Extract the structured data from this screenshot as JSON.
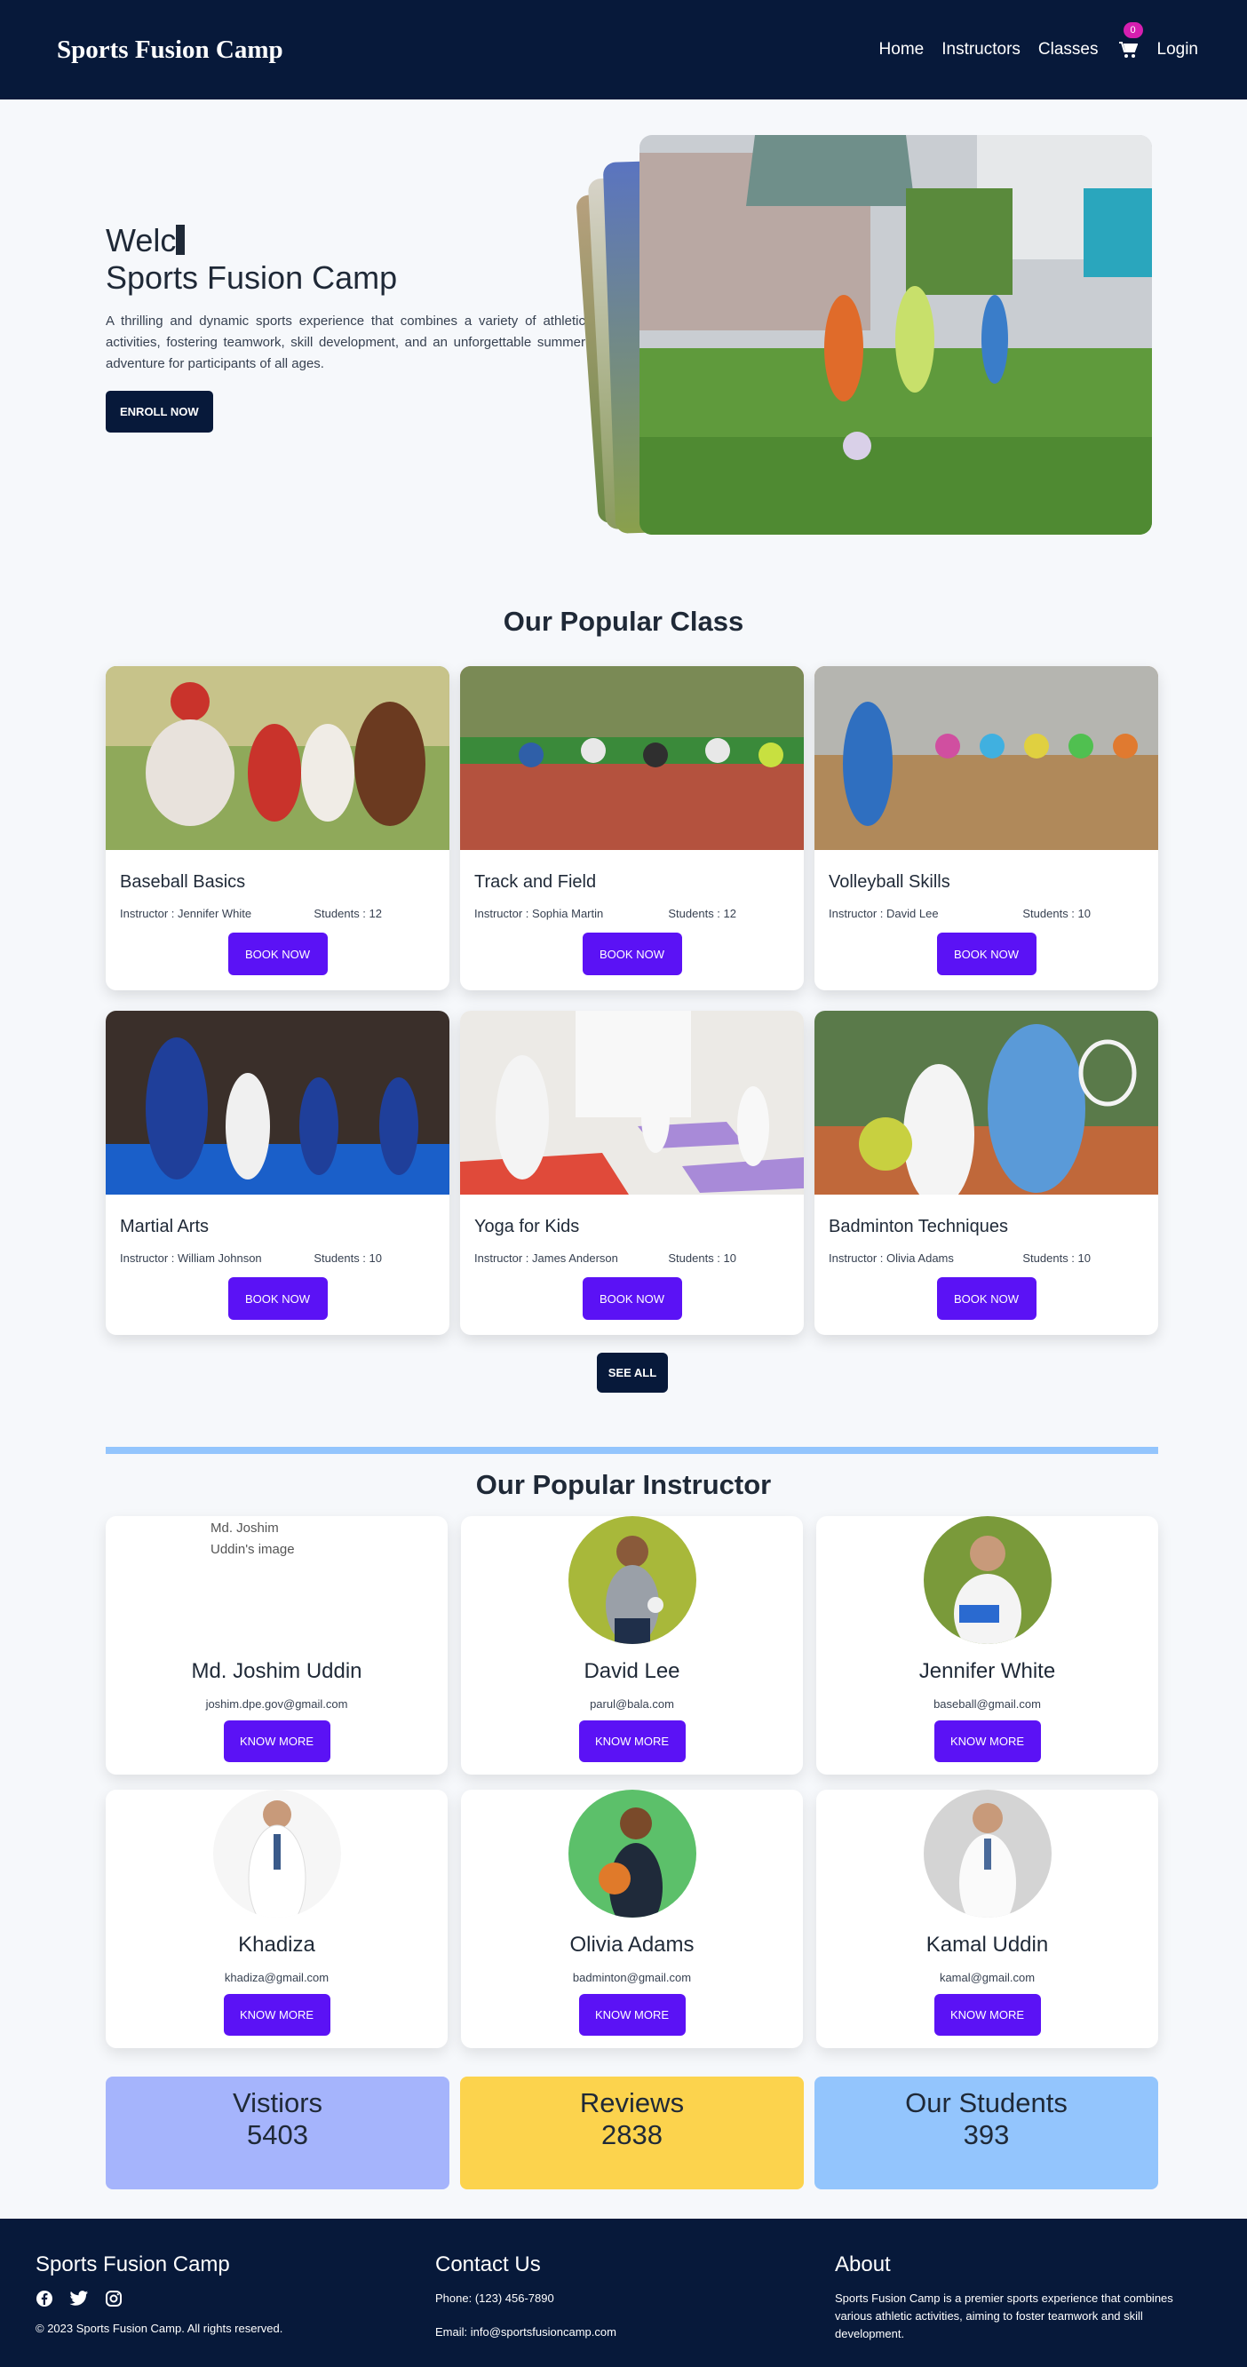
{
  "brand": "Sports Fusion Camp",
  "nav": {
    "home": "Home",
    "instructors": "Instructors",
    "classes": "Classes",
    "cart_count": "0",
    "login": "Login"
  },
  "hero": {
    "line1": "Welc",
    "line2": "Sports Fusion Camp",
    "description": "A thrilling and dynamic sports experience that combines a variety of athletic activities, fostering teamwork, skill development, and an unforgettable summer adventure for participants of all ages.",
    "cta": "ENROLL NOW"
  },
  "popular_class": {
    "title": "Our Popular Class",
    "classes": [
      {
        "name": "Baseball Basics",
        "instructor": "Instructor : Jennifer White",
        "students": "Students : 12",
        "button": "BOOK NOW"
      },
      {
        "name": "Track and Field",
        "instructor": "Instructor : Sophia Martin",
        "students": "Students : 12",
        "button": "BOOK NOW"
      },
      {
        "name": "Volleyball Skills",
        "instructor": "Instructor : David Lee",
        "students": "Students : 10",
        "button": "BOOK NOW"
      },
      {
        "name": "Martial Arts",
        "instructor": "Instructor : William Johnson",
        "students": "Students : 10",
        "button": "BOOK NOW"
      },
      {
        "name": "Yoga for Kids",
        "instructor": "Instructor : James Anderson",
        "students": "Students : 10",
        "button": "BOOK NOW"
      },
      {
        "name": "Badminton Techniques",
        "instructor": "Instructor : Olivia Adams",
        "students": "Students : 10",
        "button": "BOOK NOW"
      }
    ],
    "see_all": "SEE ALL"
  },
  "popular_instructor": {
    "title": "Our Popular Instructor",
    "instructors": [
      {
        "name": "Md. Joshim Uddin",
        "email": "joshim.dpe.gov@gmail.com",
        "button": "KNOW MORE",
        "alt": "Md. Joshim Uddin's image"
      },
      {
        "name": "David Lee",
        "email": "parul@bala.com",
        "button": "KNOW MORE"
      },
      {
        "name": "Jennifer White",
        "email": "baseball@gmail.com",
        "button": "KNOW MORE"
      },
      {
        "name": "Khadiza",
        "email": "khadiza@gmail.com",
        "button": "KNOW MORE"
      },
      {
        "name": "Olivia Adams",
        "email": "badminton@gmail.com",
        "button": "KNOW MORE"
      },
      {
        "name": "Kamal Uddin",
        "email": "kamal@gmail.com",
        "button": "KNOW MORE"
      }
    ]
  },
  "stats": [
    {
      "label": "Vistiors",
      "value": "5403",
      "color": "#a5b4fc"
    },
    {
      "label": "Reviews",
      "value": "2838",
      "color": "#fcd34d"
    },
    {
      "label": "Our Students",
      "value": "393",
      "color": "#93c5fd"
    }
  ],
  "footer": {
    "brand": "Sports Fusion Camp",
    "copyright": "© 2023 Sports Fusion Camp. All rights reserved.",
    "contact_title": "Contact Us",
    "phone": "Phone: (123) 456-7890",
    "email": "Email: info@sportsfusioncamp.com",
    "about_title": "About",
    "about_text": "Sports Fusion Camp is a premier sports experience that combines various athletic activities, aiming to foster teamwork and skill development."
  },
  "colors": {
    "navy": "#07193a",
    "accent": "#5b12f5",
    "badge": "#d61fb0"
  }
}
